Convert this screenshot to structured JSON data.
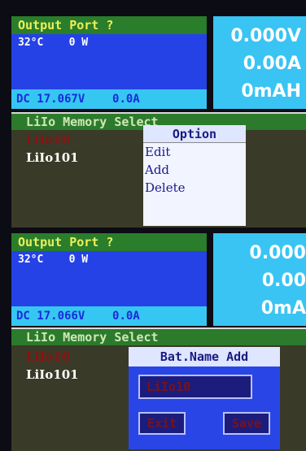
{
  "screen1": {
    "header": "Output Port ?",
    "temp": "32°C",
    "watt": "0 W",
    "dc_voltage": "DC 17.067V",
    "dc_current": "0.0A",
    "right_voltage": "0.000V",
    "right_current": "0.00A",
    "right_capacity": "0mAH",
    "memory_title": "LiIo Memory Select",
    "memory_items": [
      "LiIo10",
      "LiIo101"
    ],
    "option_title": "Option",
    "options": [
      "Edit",
      "Add",
      "Delete"
    ]
  },
  "screen2": {
    "header": "Output Port ?",
    "temp": "32°C",
    "watt": "0 W",
    "dc_voltage": "DC 17.066V",
    "dc_current": "0.0A",
    "right_voltage": "0.000",
    "right_current": "0.00",
    "right_capacity": "0mA",
    "memory_title": "LiIo Memory Select",
    "memory_items": [
      "LiIo10",
      "LiIo101"
    ],
    "dialog_title": "Bat.Name Add",
    "name_value": "LiIo10",
    "exit_label": "Exit",
    "save_label": "Save"
  }
}
